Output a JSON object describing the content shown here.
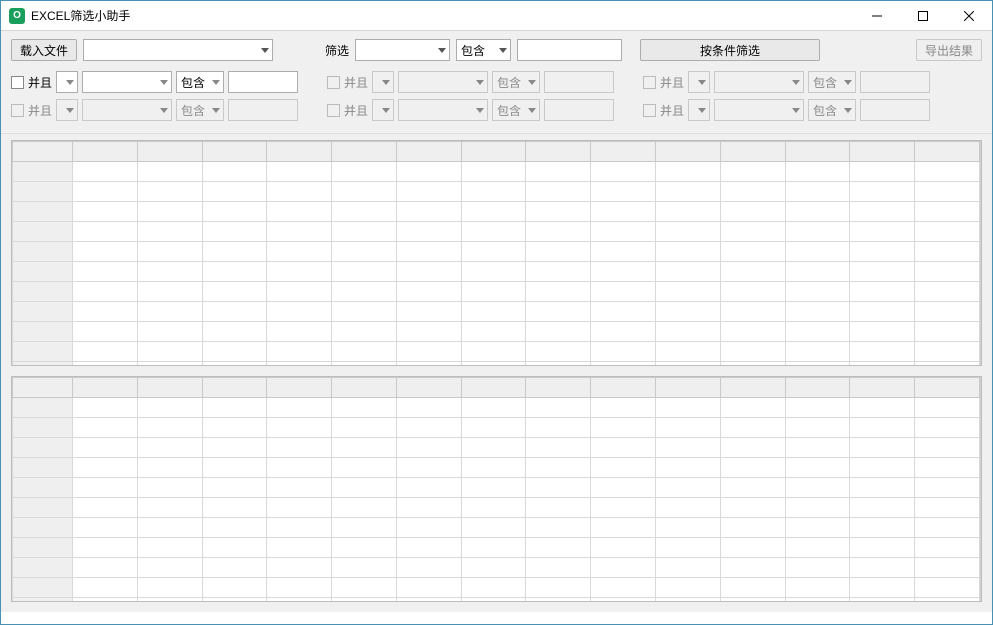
{
  "window": {
    "title": "EXCEL筛选小助手",
    "icon_letter": "O"
  },
  "toolbar": {
    "load_file_btn": "载入文件",
    "filter_label": "筛选",
    "contains_label": "包含",
    "filter_by_condition_btn": "按条件筛选",
    "export_btn": "导出结果"
  },
  "filters": {
    "groups": [
      [
        {
          "enabled": true,
          "and_label": "并且",
          "contains_label": "包含"
        },
        {
          "enabled": false,
          "and_label": "并且",
          "contains_label": "包含"
        },
        {
          "enabled": false,
          "and_label": "并且",
          "contains_label": "包含"
        }
      ],
      [
        {
          "enabled": false,
          "and_label": "并且",
          "contains_label": "包含"
        },
        {
          "enabled": false,
          "and_label": "并且",
          "contains_label": "包含"
        },
        {
          "enabled": false,
          "and_label": "并且",
          "contains_label": "包含"
        }
      ]
    ]
  },
  "grids": {
    "columns": 14,
    "top_rows": 11,
    "bottom_rows": 11
  }
}
